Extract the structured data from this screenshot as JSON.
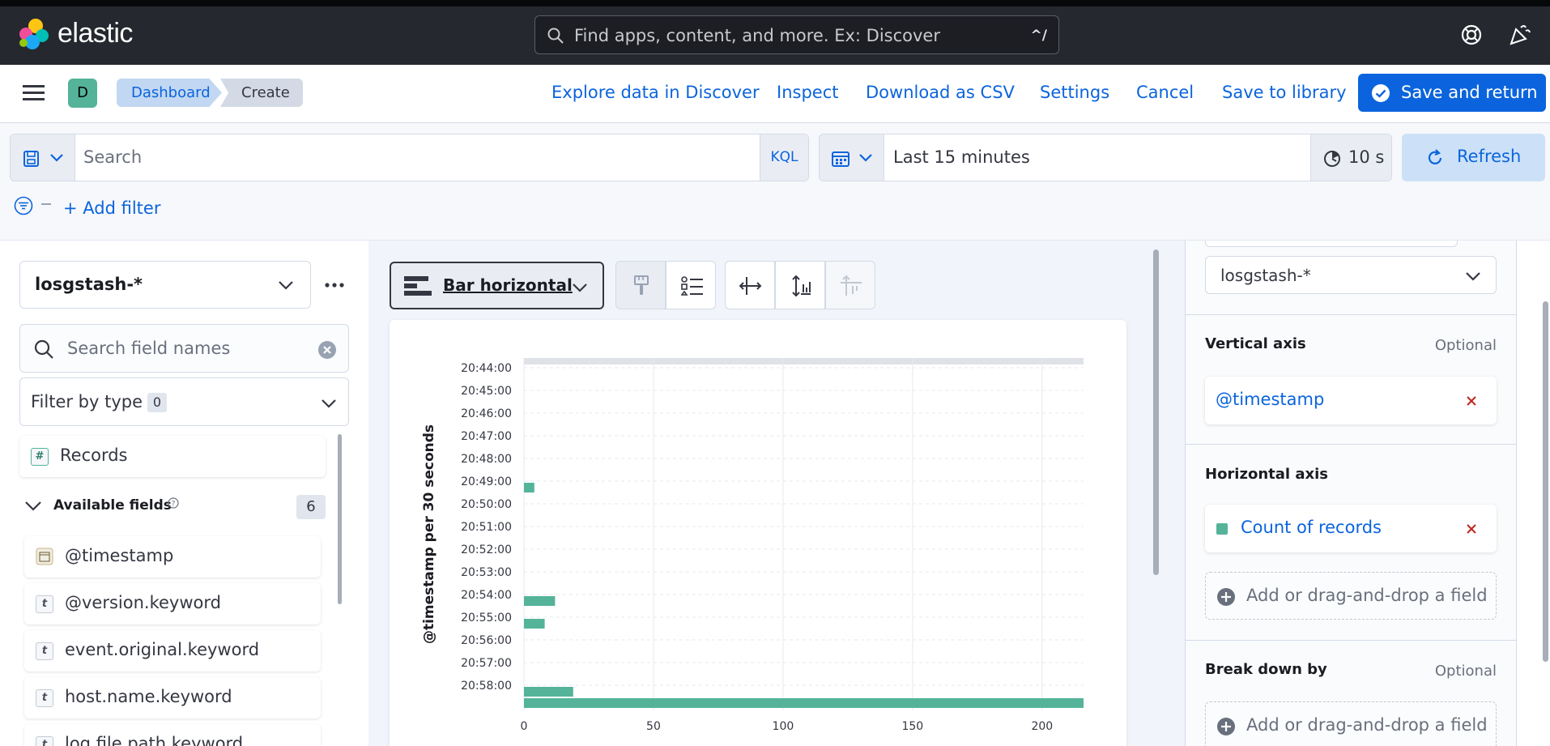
{
  "brand": {
    "name": "elastic"
  },
  "global_search": {
    "placeholder": "Find apps, content, and more. Ex: Discover",
    "shortcut": "^/"
  },
  "app_bar": {
    "avatar_letter": "D",
    "breadcrumbs": [
      "Dashboard",
      "Create"
    ],
    "actions": [
      "Explore data in Discover",
      "Inspect",
      "Download as CSV",
      "Settings",
      "Cancel",
      "Save to library"
    ],
    "primary_action": "Save and return"
  },
  "query_bar": {
    "search_placeholder": "Search",
    "language": "KQL",
    "time_range": "Last 15 minutes",
    "refresh_interval": "10 s",
    "refresh_label": "Refresh",
    "add_filter": "+ Add filter"
  },
  "left_panel": {
    "data_view": "losgstash-*",
    "field_search_placeholder": "Search field names",
    "filter_by_type_label": "Filter by type",
    "filter_by_type_count": "0",
    "records_label": "Records",
    "available_fields_label": "Available fields",
    "available_fields_count": "6",
    "fields": [
      {
        "type": "date",
        "name": "@timestamp"
      },
      {
        "type": "t",
        "name": "@version.keyword"
      },
      {
        "type": "t",
        "name": "event.original.keyword"
      },
      {
        "type": "t",
        "name": "host.name.keyword"
      },
      {
        "type": "t",
        "name": "log.file.path.keyword"
      }
    ]
  },
  "toolbar": {
    "chart_type": "Bar horizontal"
  },
  "colors": {
    "bar": "#54b399",
    "accent": "#0b64dd",
    "danger": "#bd271e"
  },
  "chart_data": {
    "type": "bar",
    "orientation": "horizontal",
    "ylabel": "@timestamp per 30 seconds",
    "xlabel": "",
    "categories": [
      "20:44:00",
      "20:45:00",
      "20:46:00",
      "20:47:00",
      "20:48:00",
      "20:49:00",
      "20:50:00",
      "20:51:00",
      "20:52:00",
      "20:53:00",
      "20:54:00",
      "20:55:00",
      "20:56:00",
      "20:57:00",
      "20:58:00"
    ],
    "x_ticks": [
      0,
      50,
      100,
      150,
      200
    ],
    "xlim": [
      0,
      216
    ],
    "bars": [
      {
        "time": "20:49:00",
        "value": 4
      },
      {
        "time": "20:54:00",
        "value": 12
      },
      {
        "time": "20:55:00",
        "value": 8
      },
      {
        "time": "20:58:00",
        "value": 19
      },
      {
        "time": "20:58:30",
        "value": 216
      }
    ],
    "grid": true
  },
  "right_panel": {
    "data_view": "losgstash-*",
    "vertical_axis_label": "Vertical axis",
    "vertical_axis_optional": "Optional",
    "vertical_axis_field": "@timestamp",
    "horizontal_axis_label": "Horizontal axis",
    "horizontal_axis_field": "Count of records",
    "add_field_label": "Add or drag-and-drop a field",
    "breakdown_label": "Break down by",
    "breakdown_optional": "Optional",
    "breakdown_add_label": "Add or drag-and-drop a field"
  }
}
